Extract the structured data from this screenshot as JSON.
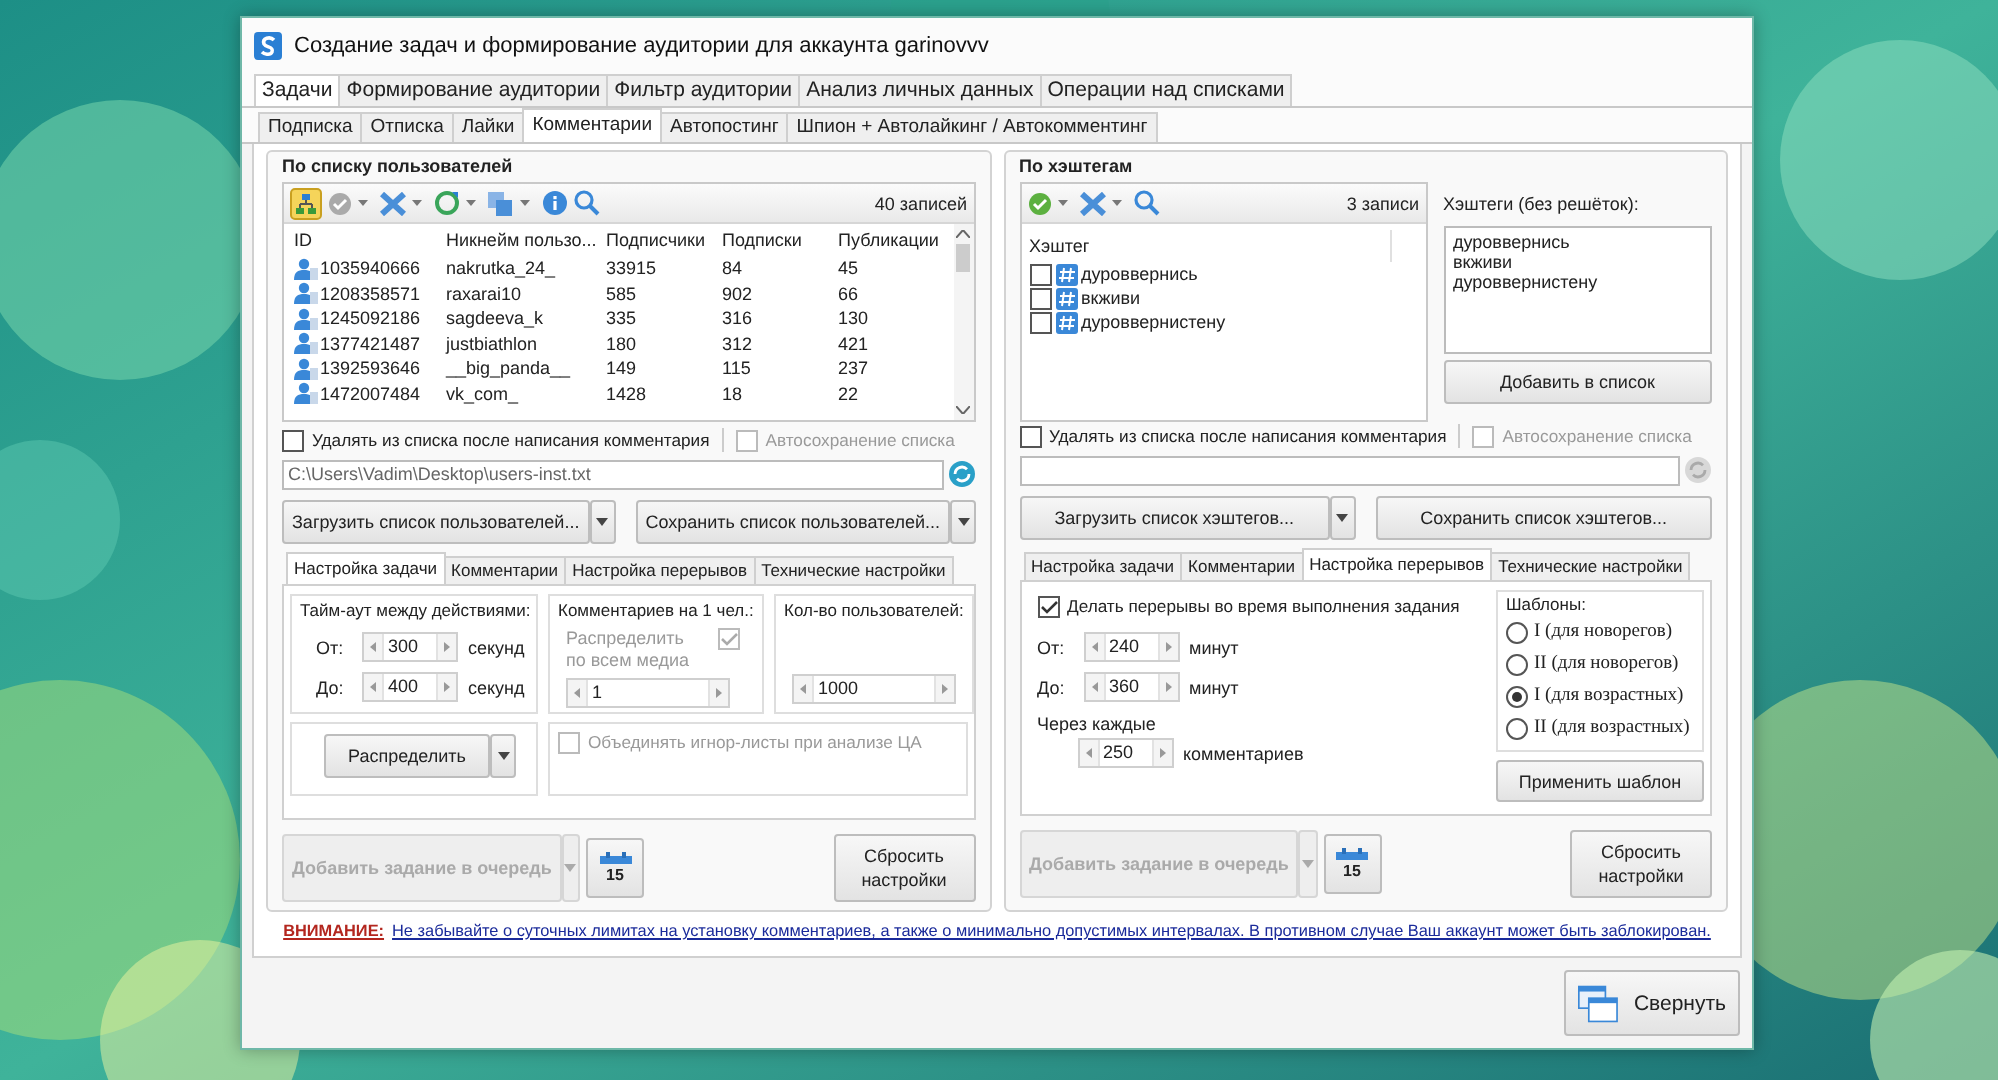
{
  "window": {
    "title": "Создание задач и формирование аудитории для аккаунта garinovvv"
  },
  "main_tabs": [
    {
      "label": "Задачи",
      "selected": true
    },
    {
      "label": "Формирование аудитории",
      "selected": false
    },
    {
      "label": "Фильтр аудитории",
      "selected": false
    },
    {
      "label": "Анализ личных данных",
      "selected": false
    },
    {
      "label": "Операции над списками",
      "selected": false
    }
  ],
  "sub_tabs": [
    {
      "label": "Подписка",
      "selected": false
    },
    {
      "label": "Отписка",
      "selected": false
    },
    {
      "label": "Лайки",
      "selected": false
    },
    {
      "label": "Комментарии",
      "selected": true
    },
    {
      "label": "Автопостинг",
      "selected": false
    },
    {
      "label": "Шпион + Автолайкинг / Автокомментинг",
      "selected": false
    }
  ],
  "panels": [
    {
      "kind": "users",
      "title": "По списку пользователей",
      "record_count": "40 записей",
      "columns": [
        "ID",
        "Никнейм пользо...",
        "Подписчики",
        "Подписки",
        "Публикации"
      ],
      "rows": [
        [
          "1035940666",
          "nakrutka_24_",
          "33915",
          "84",
          "45"
        ],
        [
          "1208358571",
          "raxarai10",
          "585",
          "902",
          "66"
        ],
        [
          "1245092186",
          "sagdeeva_k",
          "335",
          "316",
          "130"
        ],
        [
          "1377421487",
          "justbiathlon",
          "180",
          "312",
          "421"
        ],
        [
          "1392593646",
          "__big_panda__",
          "149",
          "115",
          "237"
        ],
        [
          "1472007484",
          "vk_com_",
          "1428",
          "18",
          "22"
        ]
      ],
      "delete_after": {
        "label": "Удалять из списка после написания комментария",
        "checked": false
      },
      "autosave": {
        "label": "Автосохранение списка",
        "checked": false,
        "disabled": true
      },
      "file_path": "C:\\Users\\Vadim\\Desktop\\users-inst.txt",
      "load_button": "Загрузить список пользователей...",
      "save_button": "Сохранить список пользователей...",
      "settings_tabs": [
        {
          "label": "Настройка задачи",
          "selected": true
        },
        {
          "label": "Комментарии",
          "selected": false
        },
        {
          "label": "Настройка перерывов",
          "selected": false
        },
        {
          "label": "Технические настройки",
          "selected": false
        }
      ],
      "task_settings": {
        "timeout": {
          "title": "Тайм-аут между действиями:",
          "rows": [
            {
              "label": "От:",
              "value": "300",
              "unit": "секунд"
            },
            {
              "label": "До:",
              "value": "400",
              "unit": "секунд"
            }
          ]
        },
        "comments": {
          "title": "Комментариев на 1 чел.:",
          "distribute": {
            "label": "Распределить по всем медиа",
            "checked": true,
            "disabled": true
          },
          "value": "1"
        },
        "users_count": {
          "title": "Кол-во пользователей:",
          "value": "1000"
        },
        "distribute_button": "Распределить",
        "merge": {
          "label": "Объединять игнор-листы при анализе ЦА",
          "checked": false,
          "disabled": true
        }
      },
      "add_task": {
        "label": "Добавить задание в очередь",
        "disabled": true
      },
      "calendar": "15",
      "reset_button": "Сбросить настройки"
    },
    {
      "kind": "hashtags",
      "title": "По хэштегам",
      "record_count": "3 записи",
      "column": "Хэштег",
      "items": [
        {
          "text": "дуроввернись",
          "checked": false
        },
        {
          "text": "вкживи",
          "checked": false
        },
        {
          "text": "дуроввернистену",
          "checked": false
        }
      ],
      "textarea_label": "Хэштеги (без решёток):",
      "textarea_value": "дуроввернись\nвкживи\nдуроввернистену",
      "add_button": "Добавить в список",
      "delete_after": {
        "label": "Удалять из списка после написания комментария",
        "checked": false
      },
      "autosave": {
        "label": "Автосохранение списка",
        "checked": false,
        "disabled": true
      },
      "load_button": "Загрузить список хэштегов...",
      "save_button": "Сохранить список хэштегов...",
      "settings_tabs": [
        {
          "label": "Настройка задачи",
          "selected": false
        },
        {
          "label": "Комментарии",
          "selected": false
        },
        {
          "label": "Настройка перерывов",
          "selected": true
        },
        {
          "label": "Технические настройки",
          "selected": false
        }
      ],
      "breaks": {
        "enable": {
          "label": "Делать перерывы во время выполнения задания",
          "checked": true
        },
        "rows": [
          {
            "label": "От:",
            "value": "240",
            "unit": "минут"
          },
          {
            "label": "До:",
            "value": "360",
            "unit": "минут"
          }
        ],
        "every_label": "Через каждые",
        "every": {
          "value": "250",
          "unit": "комментариев"
        },
        "templates_title": "Шаблоны:",
        "templates": [
          {
            "label": "I (для новорегов)",
            "selected": false
          },
          {
            "label": "II (для новорегов)",
            "selected": false
          },
          {
            "label": "I (для возрастных)",
            "selected": true
          },
          {
            "label": "II (для возрастных)",
            "selected": false
          }
        ],
        "apply_button": "Применить шаблон"
      },
      "add_task": {
        "label": "Добавить задание в очередь",
        "disabled": true
      },
      "calendar": "15",
      "reset_button": "Сбросить настройки"
    }
  ],
  "warning": {
    "label": "ВНИМАНИЕ:",
    "text": "Не забывайте о суточных лимитах на установку комментариев, а также о минимально допустимых интервалах. В противном случае Ваш аккаунт может быть заблокирован."
  },
  "collapse_button": "Свернуть"
}
